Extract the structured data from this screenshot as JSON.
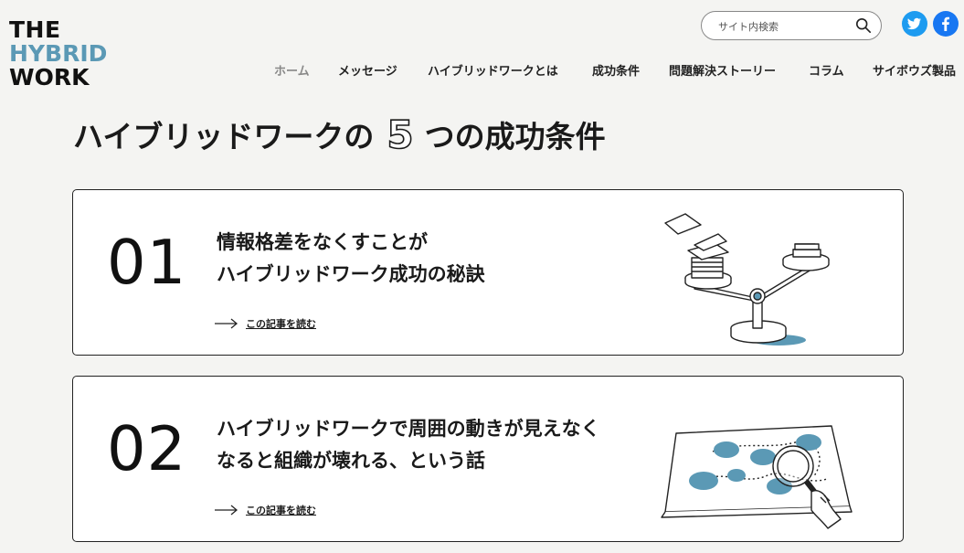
{
  "logo": {
    "line1": "THE",
    "line2": "HYBRID",
    "line3": "WORK"
  },
  "search": {
    "placeholder": "サイト内検索",
    "value": ""
  },
  "social": {
    "twitter_icon": "twitter-icon",
    "facebook_icon": "facebook-icon"
  },
  "nav": {
    "items": [
      {
        "label": "ホーム",
        "active": true
      },
      {
        "label": "メッセージ"
      },
      {
        "label": "ハイブリッドワークとは"
      },
      {
        "label": "成功条件"
      },
      {
        "label": "問題解決ストーリー"
      },
      {
        "label": "コラム"
      },
      {
        "label": "サイボウズ製品"
      }
    ]
  },
  "headline": {
    "pre": "ハイブリッドワークの",
    "num": "5",
    "post": "つの成功条件"
  },
  "cards": [
    {
      "number": "01",
      "title_line1": "情報格差をなくすことが",
      "title_line2": "ハイブリッドワーク成功の秘訣",
      "read_more": "この記事を読む",
      "illustration": "balance-scale-documents"
    },
    {
      "number": "02",
      "title_line1": "ハイブリッドワークで周囲の動きが見えなく",
      "title_line2": "なると組織が壊れる、という話",
      "read_more": "この記事を読む",
      "illustration": "map-magnifier"
    }
  ],
  "colors": {
    "accent": "#5b99b5",
    "background": "#f4f4f2",
    "twitter": "#1d9bf0",
    "facebook": "#1877f2"
  }
}
